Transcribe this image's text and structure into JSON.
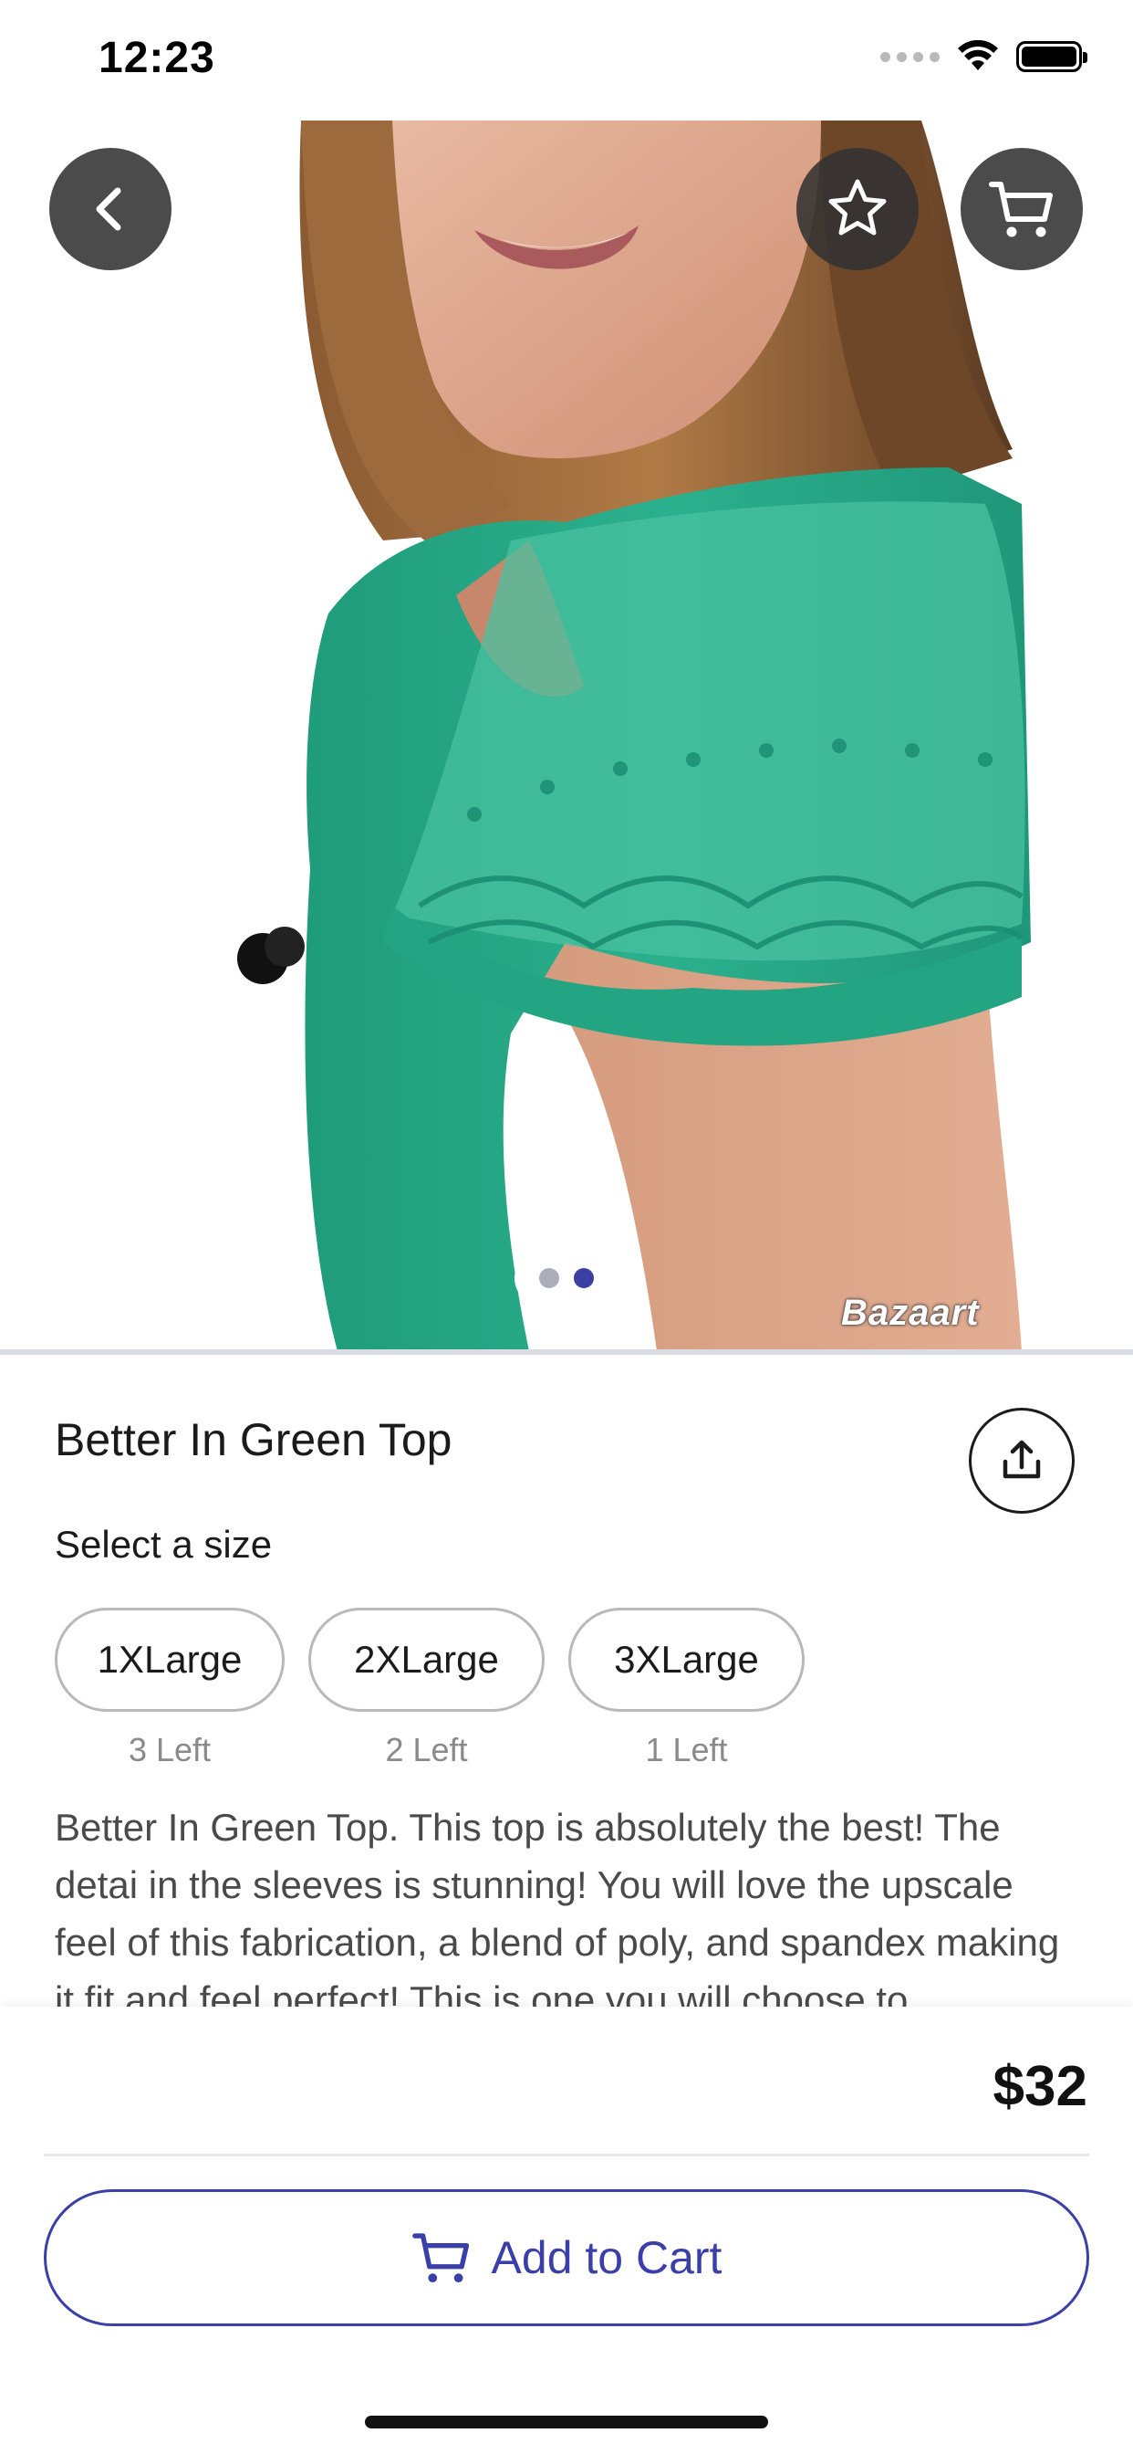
{
  "status_bar": {
    "time": "12:23",
    "signal_icon": "cellular-dots-icon",
    "wifi_icon": "wifi-icon",
    "battery_icon": "battery-icon"
  },
  "hero": {
    "watermark": "Bazaart",
    "pager": {
      "pages": 2,
      "active_index": 1
    },
    "buttons": {
      "back_icon": "chevron-left-icon",
      "favorite_icon": "star-icon",
      "cart_icon": "cart-icon"
    }
  },
  "product": {
    "title": "Better In Green Top",
    "share_icon": "share-upload-icon",
    "size_heading": "Select a size",
    "sizes": [
      {
        "label": "1XLarge",
        "stock": "3 Left"
      },
      {
        "label": "2XLarge",
        "stock": "2 Left"
      },
      {
        "label": "3XLarge",
        "stock": "1 Left"
      }
    ],
    "description": "Better In Green Top. This top is absolutely the best!  The detai in the sleeves is stunning!  You will love the upscale feel of this fabrication, a blend of poly, and spandex making it fit and feel perfect! This is one you will choose to"
  },
  "purchase": {
    "price": "$32",
    "add_to_cart_label": "Add to Cart",
    "add_to_cart_icon": "cart-icon"
  },
  "colors": {
    "accent": "#3b3fa8",
    "button_overlay": "#323232",
    "shirt_green": "#2bb08d",
    "hero_divider": "#d9dde2"
  }
}
